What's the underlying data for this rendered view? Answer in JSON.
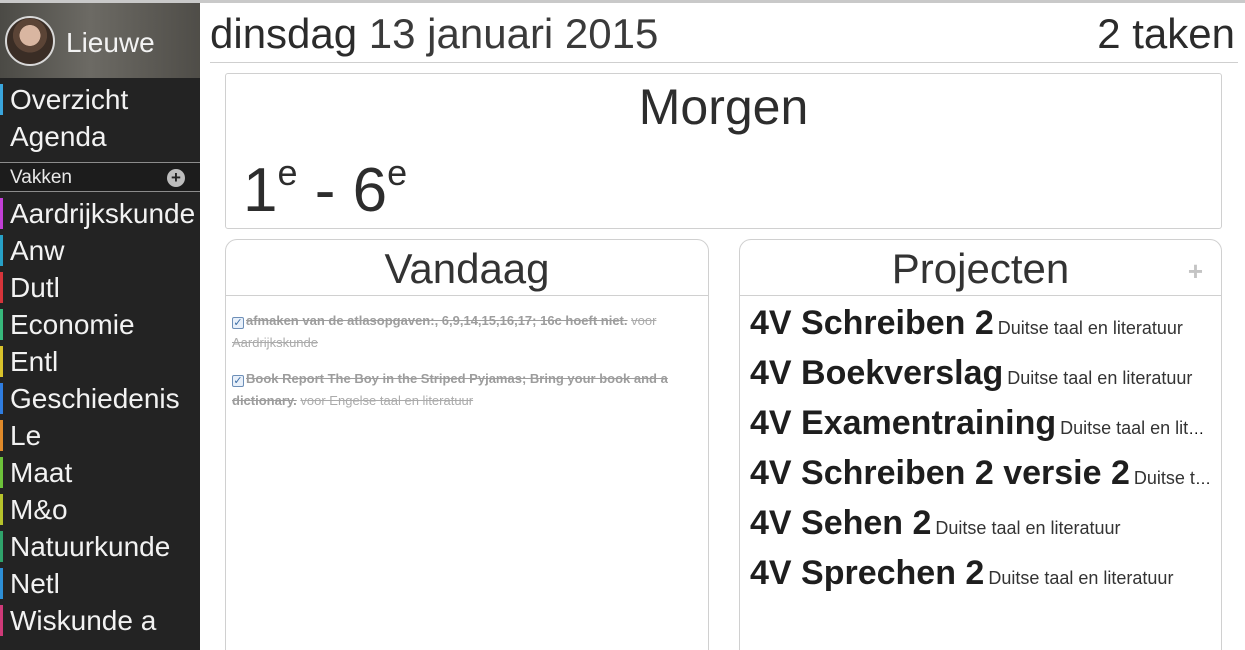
{
  "user": {
    "name": "Lieuwe"
  },
  "nav": {
    "items": [
      {
        "label": "Overzicht",
        "color": "#3aa6dd"
      },
      {
        "label": "Agenda",
        "color": ""
      }
    ]
  },
  "vakken": {
    "label": "Vakken",
    "add_icon": "plus-circle-icon",
    "items": [
      {
        "label": "Aardrijkskunde",
        "color": "#c23fd6"
      },
      {
        "label": "Anw",
        "color": "#27a1c7"
      },
      {
        "label": "Dutl",
        "color": "#d6343a"
      },
      {
        "label": "Economie",
        "color": "#37b87c"
      },
      {
        "label": "Entl",
        "color": "#d8c22b"
      },
      {
        "label": "Geschiedenis",
        "color": "#2f7de0"
      },
      {
        "label": "Le",
        "color": "#e08a2a"
      },
      {
        "label": "Maat",
        "color": "#6dc23a"
      },
      {
        "label": "M&o",
        "color": "#b6c32b"
      },
      {
        "label": "Natuurkunde",
        "color": "#2fa36b"
      },
      {
        "label": "Netl",
        "color": "#2d8fd6"
      },
      {
        "label": "Wiskunde a",
        "color": "#cf3a78"
      }
    ]
  },
  "header": {
    "weekday": "dinsdag",
    "date": "13 januari 2015",
    "task_count": "2",
    "task_word": "taken"
  },
  "morgen": {
    "title": "Morgen",
    "first_hour": "1",
    "first_sup": "e",
    "separator": " - ",
    "last_hour": "6",
    "last_sup": "e"
  },
  "vandaag": {
    "title": "Vandaag",
    "tasks": [
      {
        "description": "afmaken van de atlasopgaven:, 6,9,14,15,16,17; 16c hoeft niet.",
        "subject": "voor Aardrijkskunde",
        "done": true
      },
      {
        "description": "Book Report The Boy in the Striped Pyjamas; Bring your book and a dictionary.",
        "subject": "voor Engelse taal en literatuur",
        "done": true
      }
    ]
  },
  "projecten": {
    "title": "Projecten",
    "add_icon": "plus-icon",
    "items": [
      {
        "name": "4V Schreiben 2",
        "subject": "Duitse taal en literatuur"
      },
      {
        "name": "4V Boekverslag",
        "subject": "Duitse taal en literatuur"
      },
      {
        "name": "4V Examentraining",
        "subject": "Duitse taal en literatuur"
      },
      {
        "name": "4V Schreiben 2 versie 2",
        "subject": "Duitse taal en literatuur"
      },
      {
        "name": "4V Sehen 2",
        "subject": "Duitse taal en literatuur"
      },
      {
        "name": "4V Sprechen 2",
        "subject": "Duitse taal en literatuur"
      }
    ]
  }
}
